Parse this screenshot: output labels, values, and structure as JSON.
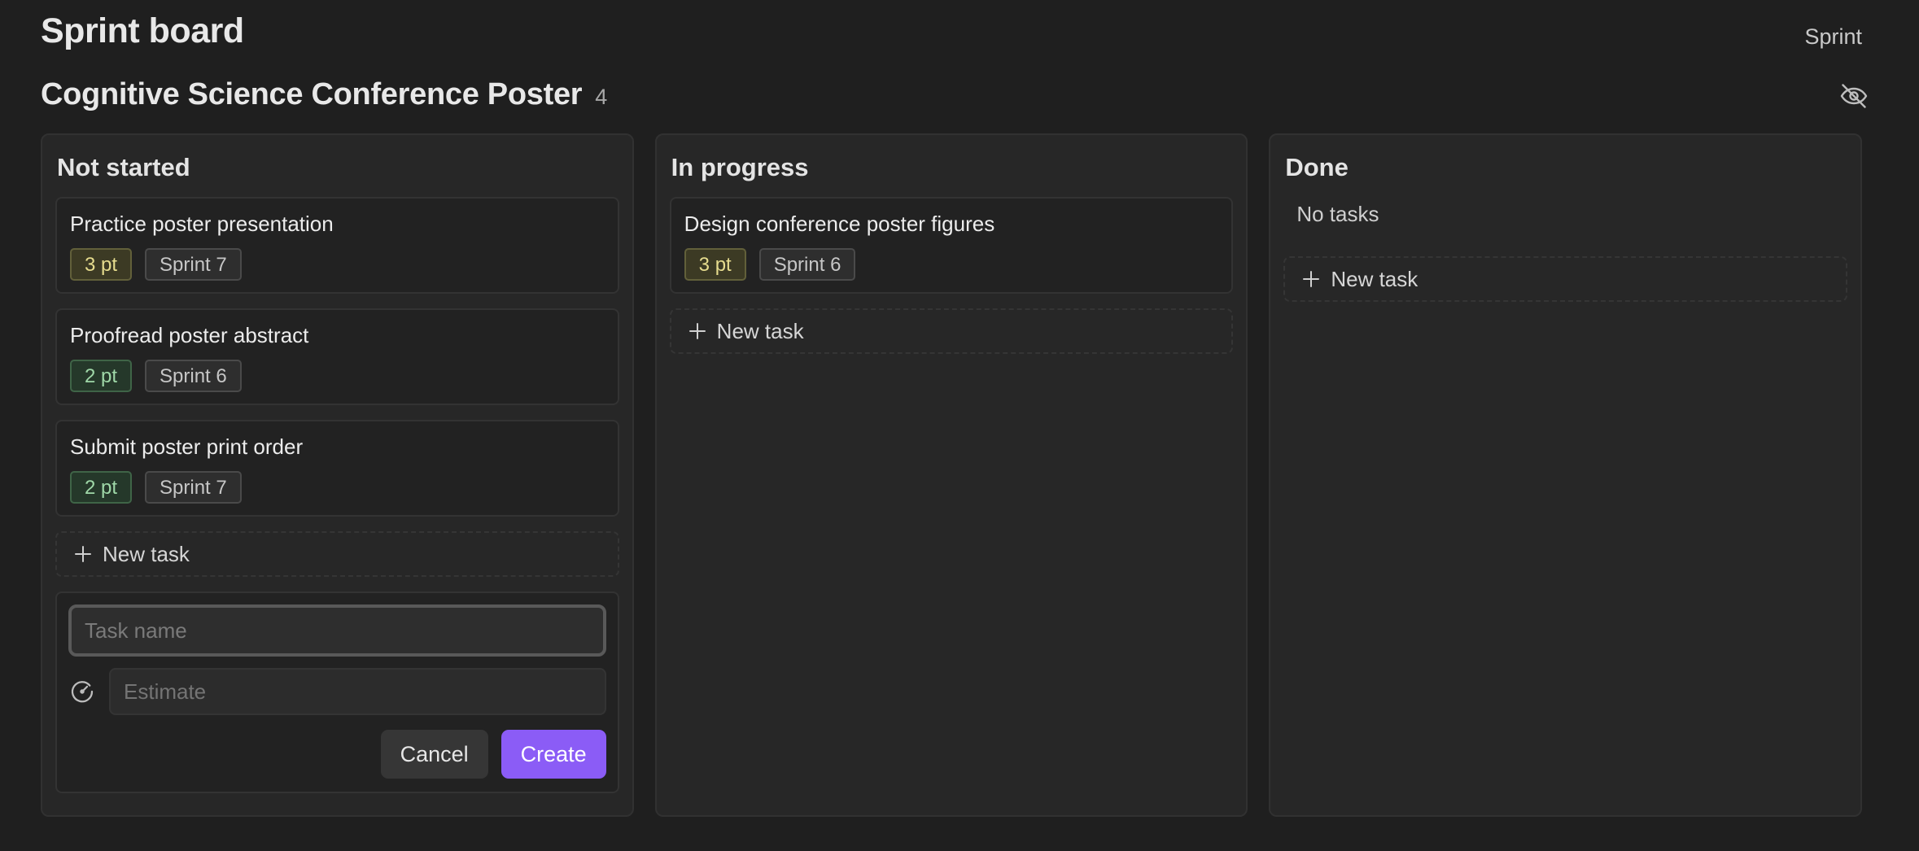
{
  "header": {
    "title": "Sprint board",
    "view_label": "Sprint"
  },
  "board": {
    "name": "Cognitive Science Conference Poster",
    "count": "4",
    "hide_icon": "eye-off-icon"
  },
  "columns": [
    {
      "title": "Not started",
      "cards": [
        {
          "title": "Practice poster presentation",
          "points": "3 pt",
          "sprint": "Sprint 7"
        },
        {
          "title": "Proofread poster abstract",
          "points": "2 pt",
          "sprint": "Sprint 6"
        },
        {
          "title": "Submit poster print order",
          "points": "2 pt",
          "sprint": "Sprint 7"
        }
      ],
      "new_task_label": "New task"
    },
    {
      "title": "In progress",
      "cards": [
        {
          "title": "Design conference poster figures",
          "points": "3 pt",
          "sprint": "Sprint 6"
        }
      ],
      "new_task_label": "New task"
    },
    {
      "title": "Done",
      "empty_text": "No tasks",
      "new_task_label": "New task"
    }
  ],
  "new_task_form": {
    "name_placeholder": "Task name",
    "estimate_placeholder": "Estimate",
    "estimate_icon": "gauge-icon",
    "cancel_label": "Cancel",
    "create_label": "Create"
  },
  "colors": {
    "background": "#1f1f1f",
    "accent": "#8b5cf6",
    "points_3": "#e6dc8e",
    "points_2": "#9fd8a8"
  }
}
